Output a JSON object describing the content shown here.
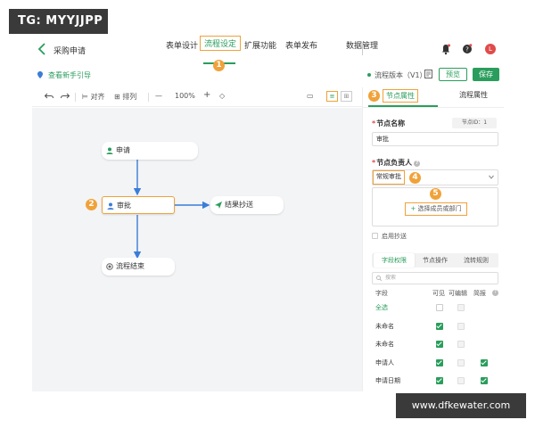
{
  "badge": "TG: MYYJJPP",
  "header": {
    "title": "采购申请",
    "tabs": [
      "表单设计",
      "流程设定",
      "扩展功能",
      "表单发布",
      "数据管理"
    ],
    "avatar_letter": "L"
  },
  "markers": [
    "1",
    "2",
    "3",
    "4",
    "5"
  ],
  "subbar": {
    "guide": "查看新手引导",
    "version": "流程版本（V1）",
    "preview": "预览",
    "save": "保存"
  },
  "toolbar": {
    "align": "对齐",
    "arrange": "排列",
    "zoom": "100%",
    "zoom_minus": "—",
    "zoom_plus": "+"
  },
  "flow": {
    "nodes": [
      "申请",
      "审批",
      "结果抄送",
      "流程结束"
    ]
  },
  "panel": {
    "tabs": [
      "节点属性",
      "流程属性"
    ],
    "node_name_label": "节点名称",
    "node_id": "节点ID：1",
    "node_name_value": "审批",
    "owner_label": "节点负责人",
    "owner_value": "常规审批",
    "select_btn": "选择成员或部门",
    "cc_label": "启用抄送",
    "subtabs": [
      "字段权限",
      "节点操作",
      "流转规则"
    ],
    "search_placeholder": "搜索",
    "columns": [
      "字段",
      "可见",
      "可编辑",
      "简报"
    ],
    "rows": [
      {
        "name": "全选",
        "visible": "off",
        "editable": "dis",
        "brief": "none"
      },
      {
        "name": "未命名",
        "visible": "on",
        "editable": "dis",
        "brief": "none"
      },
      {
        "name": "未命名",
        "visible": "on",
        "editable": "dis",
        "brief": "none"
      },
      {
        "name": "申请人",
        "visible": "on",
        "editable": "dis",
        "brief": "on"
      },
      {
        "name": "申请日期",
        "visible": "on",
        "editable": "dis",
        "brief": "on"
      }
    ]
  },
  "watermark": "www.dfkewater.com",
  "colors": {
    "accent": "#2a9d5c",
    "highlight": "#f0a23a",
    "edge": "#3b7dd8"
  }
}
